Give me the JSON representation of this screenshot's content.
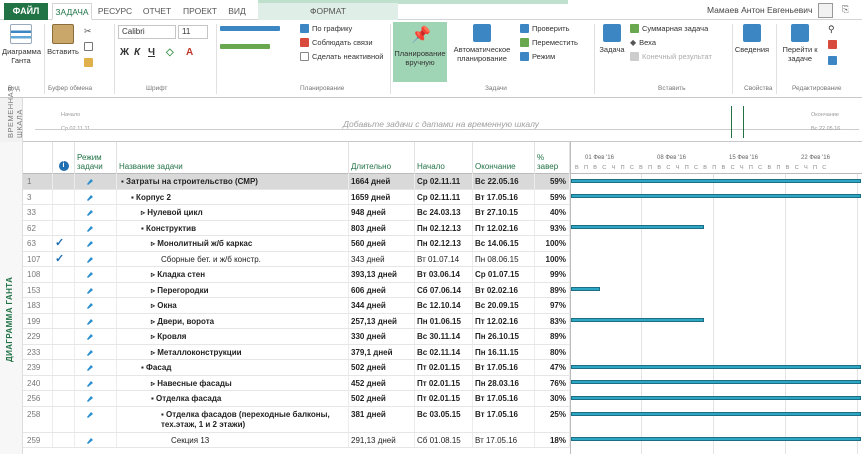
{
  "tabs": {
    "file": "ФАЙЛ",
    "items": [
      "ЗАДАЧА",
      "РЕСУРС",
      "ОТЧЕТ",
      "ПРОЕКТ",
      "ВИД",
      "ФОРМАТ"
    ],
    "active": "ЗАДАЧА"
  },
  "user": {
    "name": "Мамаев Антон Евгеньевич"
  },
  "ribbon": {
    "view": {
      "button": "Диаграмма Ганта",
      "group": "Вид"
    },
    "clipboard": {
      "paste": "Вставить",
      "group": "Буфер обмена"
    },
    "font": {
      "name": "Calibri",
      "size": "11",
      "group": "Шрифт"
    },
    "schedule": {
      "on_schedule": "По графику",
      "respect_links": "Соблюдать связи",
      "inactivate": "Сделать неактивной",
      "group": "Планирование"
    },
    "tasks": {
      "manual": "Планирование вручную",
      "auto": "Автоматическое планирование",
      "inspect": "Проверить",
      "move": "Переместить",
      "mode": "Режим",
      "group": "Задачи"
    },
    "insert": {
      "task": "Задача",
      "summary": "Суммарная задача",
      "milestone": "Веха",
      "deliverable": "Конечный результат",
      "group": "Вставить"
    },
    "properties": {
      "info": "Сведения",
      "group": "Свойства"
    },
    "editing": {
      "goto": "Перейти к задаче",
      "group": "Редактирование"
    }
  },
  "timeline": {
    "side_label": "ВРЕМЕННАЯ ШКАЛА",
    "hint": "Добавьте задачи с датами на временную шкалу",
    "start_label": "Начало",
    "start_date": "Ср 02.11.11",
    "end_label": "Окончание",
    "end_date": "Вс 22.05.16"
  },
  "gantt_side_label": "ДИАГРАММА ГАНТА",
  "columns": {
    "info": "i",
    "mode": "Режим задачи",
    "name": "Название задачи",
    "duration": "Длительно",
    "start": "Начало",
    "finish": "Окончание",
    "pct": "% завер"
  },
  "chart_header": {
    "weeks": [
      "01 Фев '16",
      "08 Фев '16",
      "15 Фев '16",
      "22 Фев '16"
    ],
    "days": "В П В С Ч П С В П В С Ч П С В П В С Ч П С В П В С Ч П С"
  },
  "rows": [
    {
      "id": "1",
      "check": "",
      "name": "▪ Затраты на строительство (СМР)",
      "indent": 0,
      "bold": true,
      "duration": "1664 дней",
      "start": "Ср 02.11.11",
      "finish": "Вс 22.05.16",
      "pct": "59%",
      "selected": true,
      "bar": [
        0,
        1.0
      ]
    },
    {
      "id": "3",
      "check": "",
      "name": "▪ Корпус 2",
      "indent": 1,
      "bold": true,
      "duration": "1659 дней",
      "start": "Ср 02.11.11",
      "finish": "Вт 17.05.16",
      "pct": "59%",
      "bar": [
        0,
        1.0
      ]
    },
    {
      "id": "33",
      "check": "",
      "name": "▹ Нулевой цикл",
      "indent": 2,
      "bold": true,
      "duration": "948 дней",
      "start": "Вс 24.03.13",
      "finish": "Вт 27.10.15",
      "pct": "40%",
      "bar": null
    },
    {
      "id": "62",
      "check": "",
      "name": "▪ Конструктив",
      "indent": 2,
      "bold": true,
      "duration": "803 дней",
      "start": "Пн 02.12.13",
      "finish": "Пт 12.02.16",
      "pct": "93%",
      "bar": [
        0,
        0.46
      ]
    },
    {
      "id": "63",
      "check": "✓",
      "name": "▹ Монолитный ж/б каркас",
      "indent": 3,
      "bold": true,
      "duration": "560 дней",
      "start": "Пн 02.12.13",
      "finish": "Вс 14.06.15",
      "pct": "100%",
      "bar": null
    },
    {
      "id": "107",
      "check": "✓",
      "name": "Сборные бет. и ж/б констр.",
      "indent": 4,
      "bold": false,
      "duration": "343 дней",
      "start": "Вт 01.07.14",
      "finish": "Пн 08.06.15",
      "pct": "100%",
      "bar": null
    },
    {
      "id": "108",
      "check": "",
      "name": "▹ Кладка стен",
      "indent": 3,
      "bold": true,
      "duration": "393,13 дней",
      "start": "Вт 03.06.14",
      "finish": "Ср 01.07.15",
      "pct": "99%",
      "bar": null
    },
    {
      "id": "153",
      "check": "",
      "name": "▹ Перегородки",
      "indent": 3,
      "bold": true,
      "duration": "606 дней",
      "start": "Сб 07.06.14",
      "finish": "Вт 02.02.16",
      "pct": "89%",
      "bar": [
        0,
        0.1
      ]
    },
    {
      "id": "183",
      "check": "",
      "name": "▹ Окна",
      "indent": 3,
      "bold": true,
      "duration": "344 дней",
      "start": "Вс 12.10.14",
      "finish": "Вс 20.09.15",
      "pct": "97%",
      "bar": null
    },
    {
      "id": "199",
      "check": "",
      "name": "▹ Двери, ворота",
      "indent": 3,
      "bold": true,
      "duration": "257,13 дней",
      "start": "Пн 01.06.15",
      "finish": "Пт 12.02.16",
      "pct": "83%",
      "bar": [
        0,
        0.46
      ]
    },
    {
      "id": "229",
      "check": "",
      "name": "▹ Кровля",
      "indent": 3,
      "bold": true,
      "duration": "330 дней",
      "start": "Вс 30.11.14",
      "finish": "Пн 26.10.15",
      "pct": "89%",
      "bar": null
    },
    {
      "id": "233",
      "check": "",
      "name": "▹ Металлоконструкции",
      "indent": 3,
      "bold": true,
      "duration": "379,1 дней",
      "start": "Вс 02.11.14",
      "finish": "Пн 16.11.15",
      "pct": "80%",
      "bar": null
    },
    {
      "id": "239",
      "check": "",
      "name": "▪ Фасад",
      "indent": 2,
      "bold": true,
      "duration": "502 дней",
      "start": "Пт 02.01.15",
      "finish": "Вт 17.05.16",
      "pct": "47%",
      "bar": [
        0,
        1.0
      ]
    },
    {
      "id": "240",
      "check": "",
      "name": "▹ Навесные фасады",
      "indent": 3,
      "bold": true,
      "duration": "452 дней",
      "start": "Пт 02.01.15",
      "finish": "Пн 28.03.16",
      "pct": "76%",
      "bar": [
        0,
        1.0
      ]
    },
    {
      "id": "256",
      "check": "",
      "name": "▪ Отделка фасада",
      "indent": 3,
      "bold": true,
      "duration": "502 дней",
      "start": "Пт 02.01.15",
      "finish": "Вт 17.05.16",
      "pct": "30%",
      "bar": [
        0,
        1.0
      ]
    },
    {
      "id": "258",
      "check": "",
      "name": "▪ Отделка фасадов (переходные балконы, тех.этаж, 1 и 2 этажи)",
      "indent": 4,
      "bold": true,
      "duration": "381 дней",
      "start": "Вс 03.05.15",
      "finish": "Вт 17.05.16",
      "pct": "25%",
      "bar": [
        0,
        1.0
      ],
      "tall": true
    },
    {
      "id": "259",
      "check": "",
      "name": "Секция 13",
      "indent": 5,
      "bold": false,
      "duration": "291,13 дней",
      "start": "Сб 01.08.15",
      "finish": "Вт 17.05.16",
      "pct": "18%",
      "bar": [
        0,
        1.0
      ]
    }
  ],
  "colors": {
    "accent": "#217346",
    "bar": "#2ea7c4",
    "selected": "#d9d9d9"
  }
}
